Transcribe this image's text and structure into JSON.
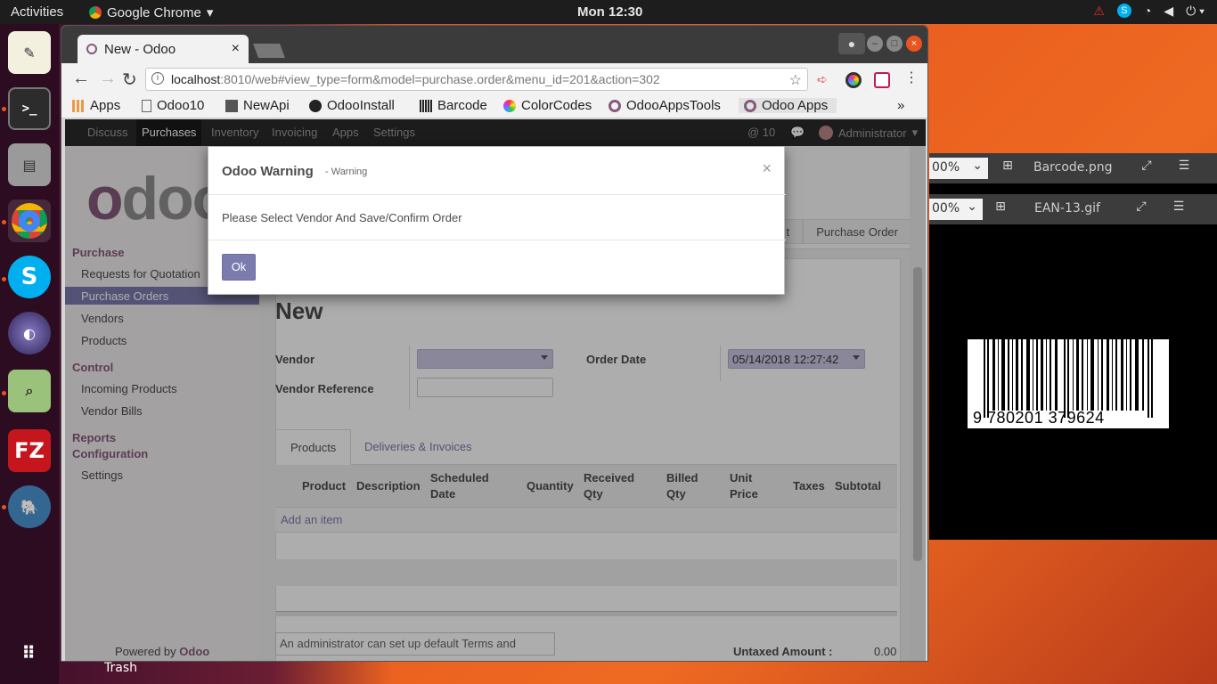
{
  "topbar": {
    "activities": "Activities",
    "app_name": "Google Chrome",
    "clock": "Mon 12:30"
  },
  "chrome": {
    "tab_title": "New - Odoo",
    "url_host": "localhost",
    "url_path": ":8010/web#view_type=form&model=purchase.order&menu_id=201&action=302",
    "bookmarks": [
      "Apps",
      "Odoo10",
      "NewApi",
      "OdooInstall",
      "Barcode",
      "ColorCodes",
      "OdooAppsTools",
      "Odoo Apps"
    ],
    "bookmarks_more": "»"
  },
  "odoo": {
    "nav": [
      "Discuss",
      "Purchases",
      "Inventory",
      "Invoicing",
      "Apps",
      "Settings"
    ],
    "chat_count": "@ 10",
    "user": "Administrator",
    "logo": "odoo",
    "sidebar": {
      "purchase_header": "Purchase",
      "purchase_items": [
        "Requests for Quotation",
        "Purchase Orders",
        "Vendors",
        "Products"
      ],
      "control_header": "Control",
      "control_items": [
        "Incoming Products",
        "Vendor Bills"
      ],
      "reports_header": "Reports",
      "config_header": "Configuration",
      "config_items": [
        "Settings"
      ],
      "powered_prefix": "Powered by",
      "powered_brand": "Odoo"
    },
    "breadcrumb": [
      "t",
      "Purchase Order"
    ],
    "form": {
      "title": "New",
      "vendor_label": "Vendor",
      "vendor_ref_label": "Vendor Reference",
      "order_date_label": "Order Date",
      "order_date_value": "05/14/2018 12:27:42",
      "tabs": [
        "Products",
        "Deliveries & Invoices"
      ],
      "columns": [
        "Product",
        "Description",
        "Scheduled Date",
        "Quantity",
        "Received Qty",
        "Billed Qty",
        "Unit Price",
        "Taxes",
        "Subtotal"
      ],
      "add_item": "Add an item",
      "terms_placeholder": "An administrator can set up default Terms and",
      "untaxed_label": "Untaxed Amount :",
      "untaxed_value": "0.00"
    },
    "dialog": {
      "title": "Odoo Warning",
      "subtitle": "- Warning",
      "close": "×",
      "message": "Please Select Vendor And Save/Confirm Order",
      "ok": "Ok"
    }
  },
  "viewer": {
    "top_zoom": "00%",
    "top_file": "Barcode.png",
    "bottom_zoom": "00%",
    "bottom_file": "EAN-13.gif",
    "barcode_digits": "9  780201  379624"
  },
  "desktop": {
    "trash_label": "Trash"
  },
  "colors": {
    "odoo_accent": "#875a7b",
    "odoo_button": "#7c7bad",
    "ubuntu_orange": "#e95420"
  }
}
